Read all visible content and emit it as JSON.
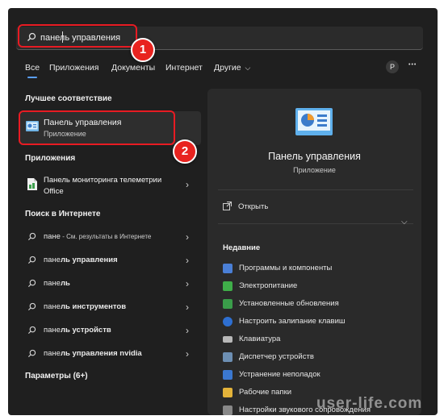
{
  "search": {
    "value": "панель управления"
  },
  "badges": {
    "one": "1",
    "two": "2"
  },
  "tabs": [
    {
      "label": "Все"
    },
    {
      "label": "Приложения"
    },
    {
      "label": "Документы"
    },
    {
      "label": "Интернет"
    },
    {
      "label": "Другие"
    }
  ],
  "tab_more_chevron": "⌵",
  "profile_initial": "P",
  "more_dots": "•••",
  "best_match": {
    "heading": "Лучшее соответствие",
    "title": "Панель управления",
    "subtitle": "Приложение"
  },
  "apps": {
    "heading": "Приложения",
    "items": [
      {
        "title_line1": "Панель мониторинга телеметрии",
        "title_line2": "Office"
      }
    ]
  },
  "web": {
    "heading": "Поиск в Интернете",
    "items": [
      {
        "bold": "пане",
        "rest": " - См. результаты в Интернете"
      },
      {
        "bold": "панель управления",
        "rest": ""
      },
      {
        "bold": "панель",
        "rest": ""
      },
      {
        "bold": "панель инструментов",
        "rest": ""
      },
      {
        "bold": "панель устройств",
        "rest": ""
      },
      {
        "bold": "панель управления nvidia",
        "rest": ""
      }
    ]
  },
  "settings": {
    "heading": "Параметры (6+)"
  },
  "detail": {
    "title": "Панель управления",
    "subtitle": "Приложение",
    "open_label": "Открыть",
    "recent_heading": "Недавние",
    "recent": [
      {
        "label": "Программы и компоненты",
        "icon": "programs-icon",
        "color": "#4a7fd6"
      },
      {
        "label": "Электропитание",
        "icon": "power-icon",
        "color": "#3fae49"
      },
      {
        "label": "Установленные обновления",
        "icon": "updates-icon",
        "color": "#3a9d4a"
      },
      {
        "label": "Настроить залипание клавиш",
        "icon": "accessibility-icon",
        "color": "#2e6fd1"
      },
      {
        "label": "Клавиатура",
        "icon": "keyboard-icon",
        "color": "#b8b8b8"
      },
      {
        "label": "Диспетчер устройств",
        "icon": "device-manager-icon",
        "color": "#6d8fb3"
      },
      {
        "label": "Устранение неполадок",
        "icon": "troubleshoot-icon",
        "color": "#3b78d0"
      },
      {
        "label": "Рабочие папки",
        "icon": "work-folders-icon",
        "color": "#e3b33a"
      },
      {
        "label": "Настройки звукового сопровождения",
        "icon": "sound-icon",
        "color": "#888888"
      }
    ]
  },
  "watermark": "user-life.com"
}
